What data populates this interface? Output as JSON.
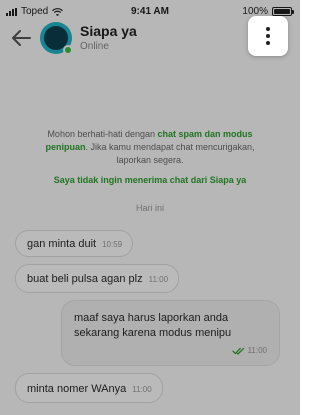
{
  "status_bar": {
    "carrier": "Toped",
    "time": "9:41 AM",
    "battery": "100%",
    "battery_level": 1.0
  },
  "header": {
    "back_icon": "arrow-left-icon",
    "contact_name": "Siapa ya",
    "contact_status": "Online",
    "more_icon": "more-vertical-icon"
  },
  "notice": {
    "text_before": "Mohon berhati-hati dengan ",
    "highlight": "chat spam dan modus penipuan",
    "text_after": ". Jika kamu mendapat chat mencurigakan, laporkan segera.",
    "link": "Saya tidak ingin menerima chat dari Siapa ya"
  },
  "date_separator": "Hari ini",
  "messages": [
    {
      "text": "gan minta duit",
      "time": "10:59"
    },
    {
      "text": "buat beli pulsa agan plz",
      "time": "11:00"
    },
    {
      "text": "maaf saya harus laporkan anda sekarang karena modus menipu",
      "time": "11:00"
    },
    {
      "text": "minta nomer WAnya",
      "time": "11:00"
    }
  ],
  "colors": {
    "accent_green": "#2fa12f",
    "online_dot": "#3bbf45",
    "avatar": "#23b5c8",
    "overlay": "rgba(0,0,0,0.27)"
  }
}
